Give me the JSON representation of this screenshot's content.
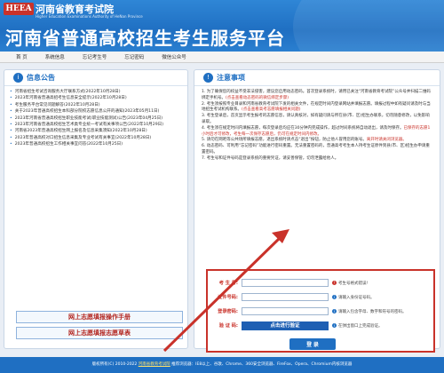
{
  "header": {
    "logo_text": "HEEA",
    "org_cn": "河南省教育考试院",
    "org_en": "Higher Education Examinations Authority of HeNan Province",
    "platform_title": "河南省普通高校招生考生服务平台"
  },
  "nav": {
    "items": [
      {
        "label": "首 页"
      },
      {
        "label": "系统信息"
      },
      {
        "label": "忘记考生号"
      },
      {
        "label": "忘记密码"
      },
      {
        "label": "微信公众号"
      }
    ]
  },
  "info_panel": {
    "title": "信息公告",
    "items": [
      "河南省招生考试咨询服务大厅联系方式(2022年10月28日)",
      "2023年河南省普通高招考生信息安全提示(2022年10月28日)",
      "考生服务平台常见问题解答(2022年10月28日)",
      "关于2023年普通高校招生本科部分院校志愿信息公开的通知(2023年05月11日)",
      "2023年河南省普通高校招生职业技能考试(职业技能测试)公告(2023年04月25日)",
      "2023年河南省普通高校招生艺术类专业统一考试有关事项公告(2022年10月29日)",
      "河南省2023年普通高校招生网上报名及信息采集须知(2022年10月28日)",
      "2023年普通高校对口招生信息采集及专业考试有关事宜(2022年10月28日)",
      "2023年普通高校招生工作相关事宜问答(2022年10月25日)"
    ],
    "link_manual": "网上志愿填报操作手册",
    "link_form": "网上志愿填报志愿草表"
  },
  "notice_panel": {
    "title": "注意事项",
    "rules": [
      {
        "text": "1. 为了确保您的权益不受非法侵害，建议您启用动态密码。首次登录系统时，请用已关注“河南省教育考试院”公众号并扫描二维码绑定手机号。",
        "red": "(点击查看动态密码的微信绑定步骤)"
      },
      {
        "text": "2. 考生须按照专业目录和河南省教育考试院下发的相关文件，在规定时间内登录网站并填报志愿。填报过程中如有疑问请及时与当地招生考试机构联系。",
        "red": "(点击查看高考志愿填报相关问题)"
      },
      {
        "text": "3. 考生登录后，首页显示考生报考的志愿信息，请认真核对，如有疑问请与所在县(市、区)招生办联系，切勿随意修改，以免影响录取。",
        "red": ""
      },
      {
        "text": "4. 考生须在规定时间内填报志愿，每次登录后均应在30分钟内完成操作，超过时间系统将自动退出，请及时保存。",
        "red": "已保存的志愿1小时后才可修改，考生每一次保存志愿后，仍可在规定时间内修改。"
      },
      {
        "text": "5. 请勿在网吧等公共场所填报志愿，退出系统时请点击“退出”按钮，防止他人冒用您的账号。",
        "red": "离开时请关闭浏览器。"
      },
      {
        "text": "6. 动态密码、可利用“忘记密码”功能进行密码重置。无法重置密码的，普通高考考生本人持考生证原件到县(市、区)招生办申请重置密码。",
        "red": ""
      },
      {
        "text": "7. 考生号和证件号码是登录系统的重要凭证，请妥善保管，切勿泄露给他人。",
        "red": ""
      }
    ]
  },
  "login": {
    "candidate_label": "考 生 号:",
    "candidate_placeholder": "",
    "candidate_hint": "考生号格式错误!",
    "id_label": "证件号码:",
    "id_placeholder": "",
    "id_hint": "请输入身份证号码。",
    "password_label": "登录密码:",
    "password_placeholder": "",
    "password_hint": "请输入包含字母、数字和符号的密码。",
    "captcha_label": "验 证 码:",
    "captcha_button": "点击进行验证",
    "captcha_hint": "在弹出窗口上完成验证。",
    "login_button": "登 录"
  },
  "footer": {
    "text_prefix": "版权所有(C) 2010-2022",
    "link_text": "河南省教育考试院",
    "text_suffix": "推荐浏览器：IE8以上、谷歌、Chrome、360安全浏览器、FireFox、Opera、Chromium内核浏览器"
  },
  "colors": {
    "brand_blue": "#1f6fc2",
    "alert_red": "#c9322a"
  }
}
